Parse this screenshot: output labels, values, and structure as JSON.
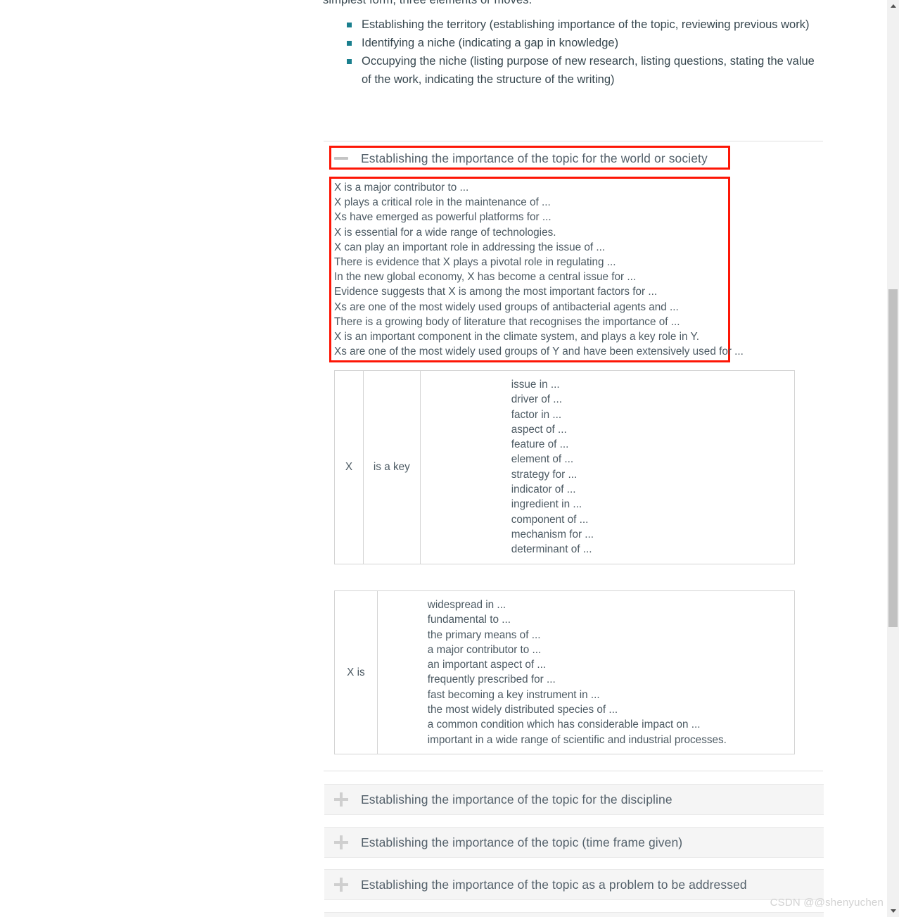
{
  "page": {
    "cut_off_line": "simplest form, three elements or moves.",
    "watermark": "CSDN @@shenyuchen"
  },
  "intro_list": {
    "bullet_color": "#1a7f8e",
    "items": [
      "Establishing the territory (establishing importance of the topic, reviewing previous work)",
      "Identifying a niche (indicating a gap in knowledge)",
      "Occupying the niche (listing purpose of new research, listing questions, stating the value of the work, indicating the structure of the writing)"
    ]
  },
  "open_section": {
    "icon": "minus-icon",
    "title": "Establishing the importance of the topic for the world or society",
    "highlight_color": "#fd1606",
    "phrases": [
      "X is a major contributor to ...",
      "X plays a critical role in the maintenance of ...",
      "Xs have emerged as powerful platforms for ...",
      "X is essential for a wide range of technologies.",
      "X can play an important role in addressing the issue of ...",
      "There is evidence that X plays a pivotal role in regulating ...",
      "In the new global economy, X has become a central issue for ...",
      "Evidence suggests that X is among the most important factors for ...",
      "Xs are one of the most widely used groups of antibacterial agents and ...",
      "There is a growing body of literature that recognises the importance of ...",
      "X is an important component in the climate system, and plays a key role in Y.",
      "Xs are one of the most widely used groups of Y and have been extensively used for ..."
    ]
  },
  "table_one": {
    "subject": "X",
    "verb": "is a key",
    "completions": [
      "issue in ...",
      "driver of ...",
      "factor in ...",
      "aspect of ...",
      "feature of ...",
      "element of ...",
      "strategy for ...",
      "indicator of ...",
      "ingredient in ...",
      "component of ...",
      "mechanism for ...",
      "determinant of ..."
    ]
  },
  "table_two": {
    "subject": "X is",
    "completions": [
      "widespread in ...",
      "fundamental to ...",
      "the primary means of ...",
      "a major contributor to ...",
      "an important aspect of ...",
      "frequently prescribed for ...",
      "fast becoming a key instrument in ...",
      "the most widely distributed species of ...",
      "a common condition which has considerable impact on ...",
      "important in a wide range of scientific and industrial processes."
    ]
  },
  "collapsed_sections": [
    {
      "icon": "plus-icon",
      "title": "Establishing the importance of the topic for the discipline"
    },
    {
      "icon": "plus-icon",
      "title": "Establishing the importance of the topic (time frame given)"
    },
    {
      "icon": "plus-icon",
      "title": "Establishing the importance of the topic as a problem to be addressed"
    }
  ]
}
